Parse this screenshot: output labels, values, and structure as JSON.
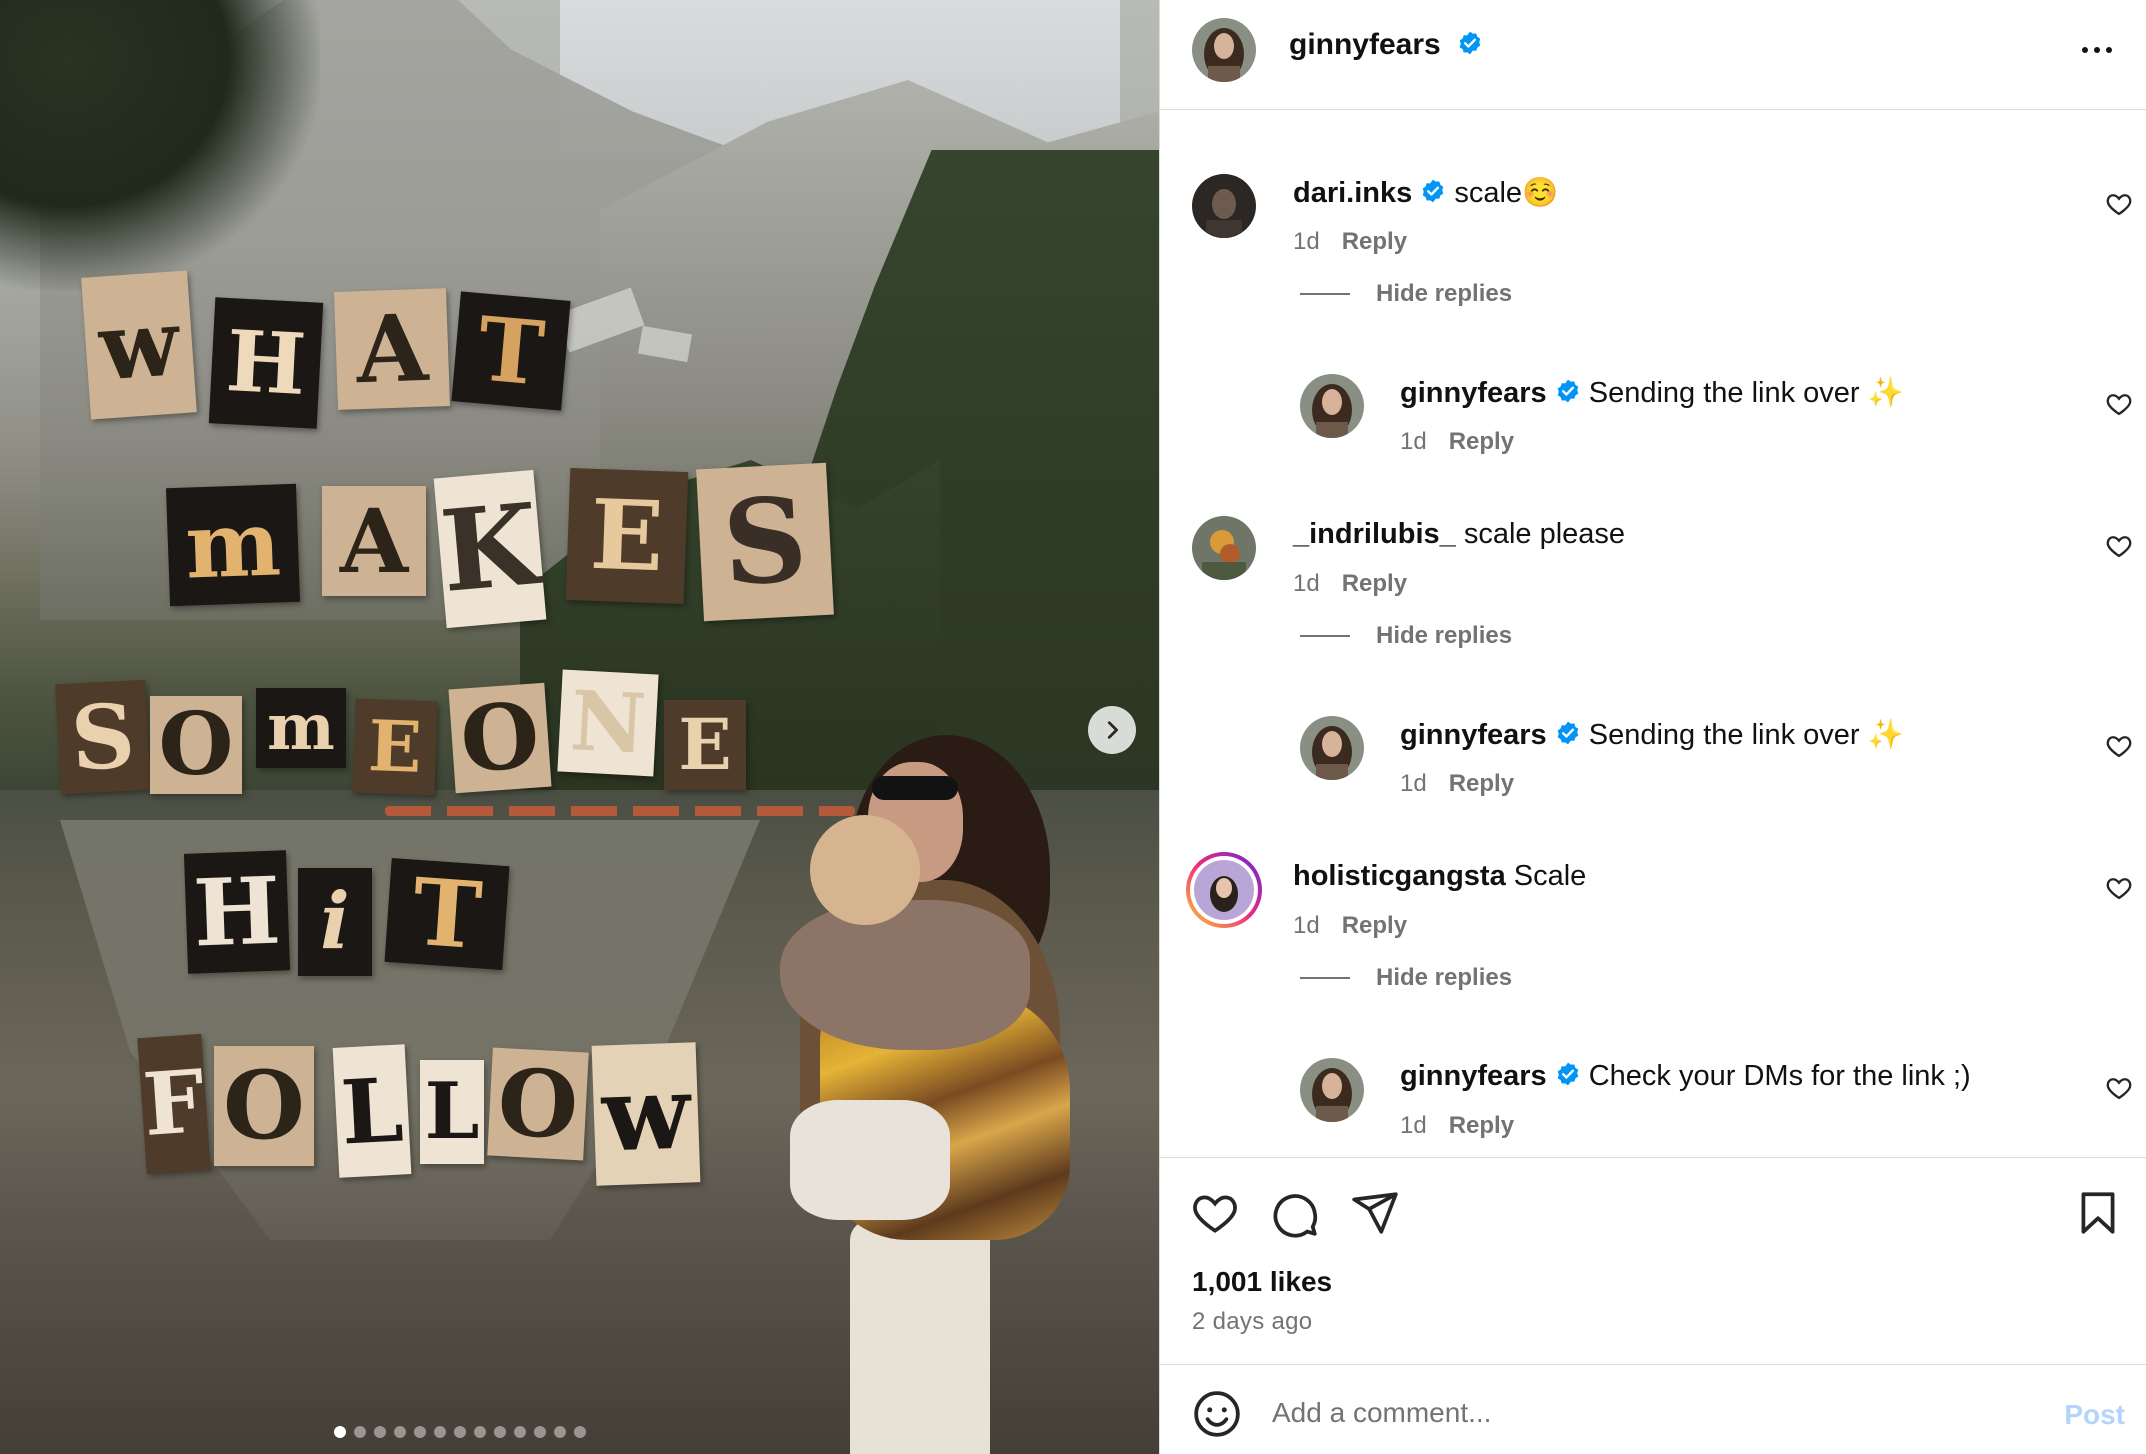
{
  "post": {
    "author": "ginnyfears",
    "overlay_text": [
      "WHAT",
      "MAKES",
      "SOMEONE",
      "HIT",
      "FOLLOW"
    ],
    "carousel": {
      "total_slides": 13,
      "active_index": 0
    }
  },
  "comments": [
    {
      "user": "dari.inks",
      "verified": true,
      "text": "scale☺️",
      "time": "1d",
      "reply_label": "Reply",
      "hide_replies_label": "Hide replies",
      "reply": {
        "user": "ginnyfears",
        "verified": true,
        "text": "Sending the link over ✨",
        "time": "1d",
        "reply_label": "Reply"
      }
    },
    {
      "user": "_indrilubis_",
      "verified": false,
      "text": "scale please",
      "time": "1d",
      "reply_label": "Reply",
      "hide_replies_label": "Hide replies",
      "reply": {
        "user": "ginnyfears",
        "verified": true,
        "text": "Sending the link over ✨",
        "time": "1d",
        "reply_label": "Reply"
      }
    },
    {
      "user": "holisticgangsta",
      "verified": false,
      "text": "Scale",
      "time": "1d",
      "reply_label": "Reply",
      "hide_replies_label": "Hide replies",
      "reply": {
        "user": "ginnyfears",
        "verified": true,
        "text": "Check your DMs for the link ;)",
        "time": "1d",
        "reply_label": "Reply"
      }
    }
  ],
  "stats": {
    "likes": "1,001 likes",
    "posted": "2 days ago"
  },
  "composer": {
    "placeholder": "Add a comment...",
    "post_label": "Post"
  },
  "colors": {
    "verified": "#0095f6",
    "post_disabled": "#b3d4fc",
    "secondary_text": "#737373"
  }
}
